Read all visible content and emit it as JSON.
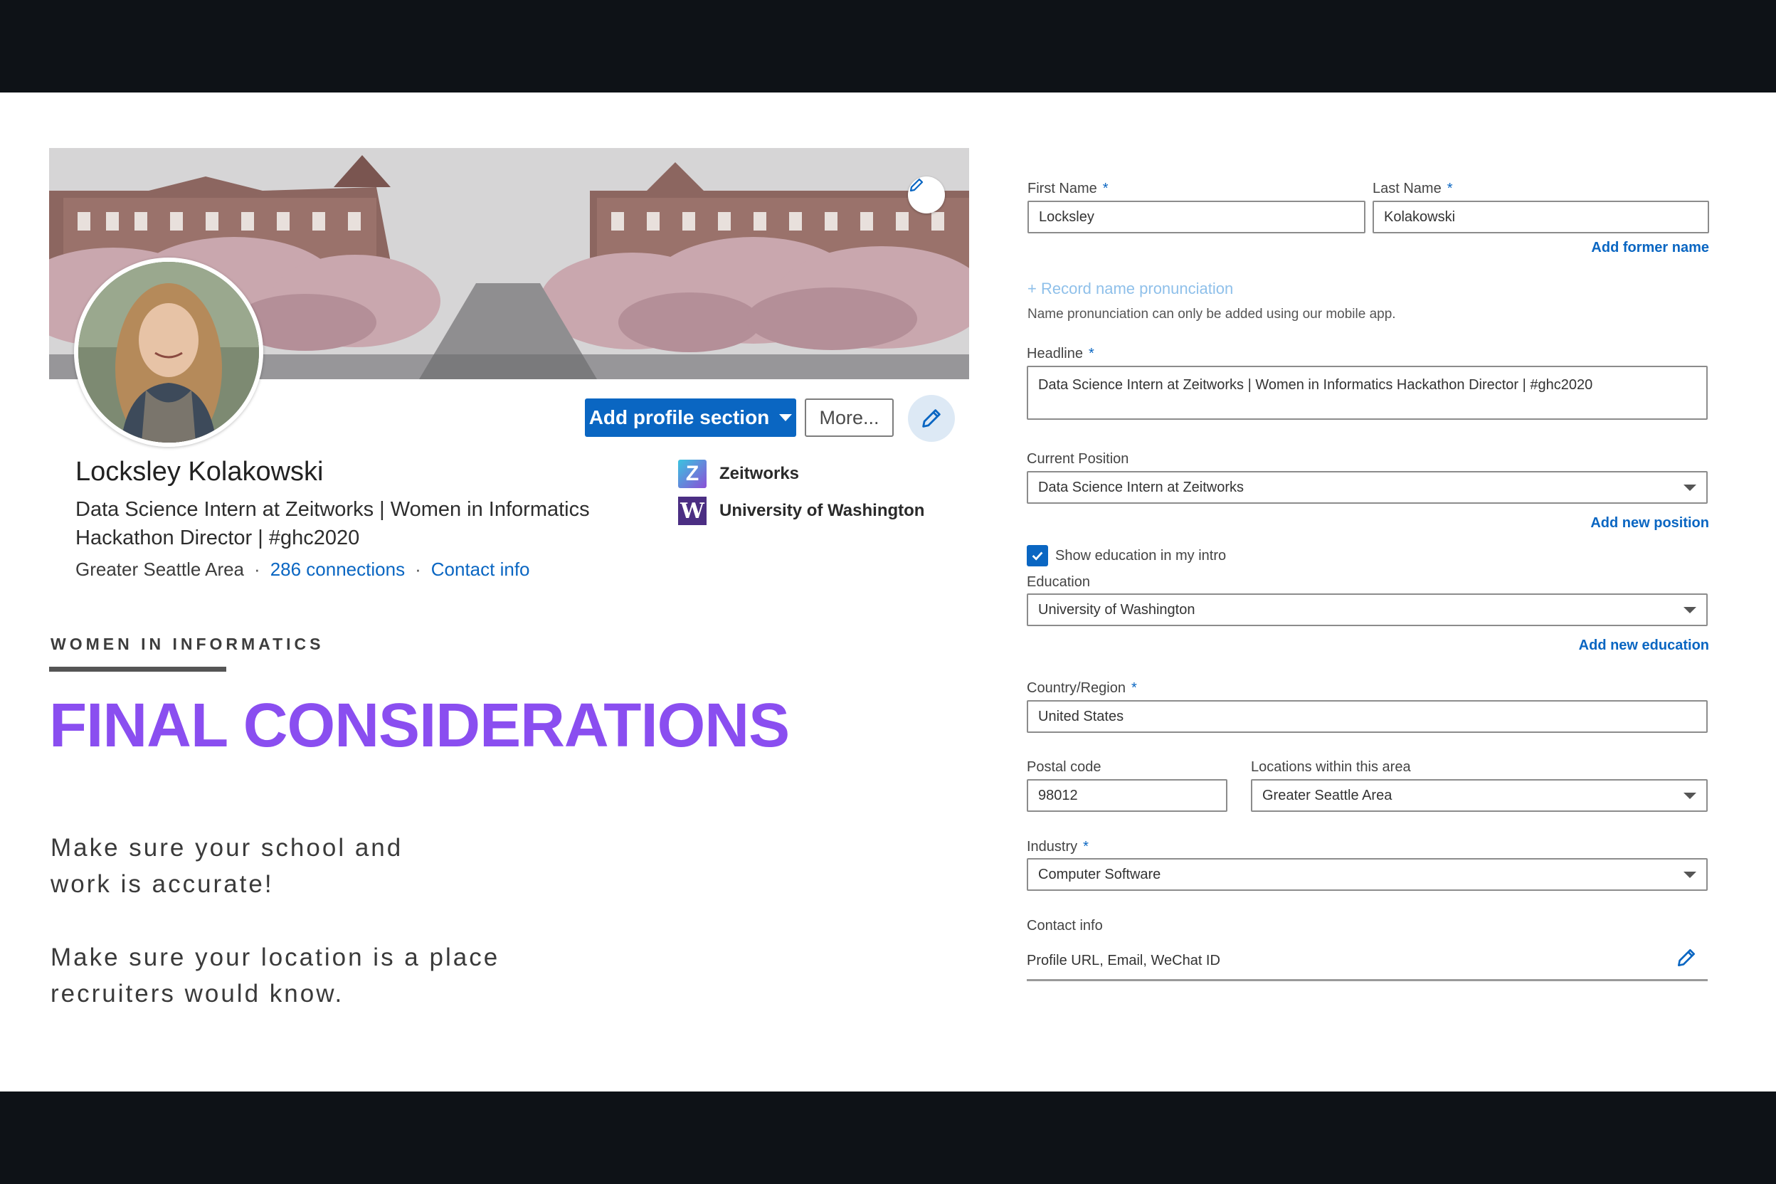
{
  "profile": {
    "name": "Locksley Kolakowski",
    "headline": "Data Science Intern at Zeitworks | Women in Informatics Hackathon Director | #ghc2020",
    "location": "Greater Seattle Area",
    "connections": "286 connections",
    "contact_info": "Contact info",
    "add_profile_section_label": "Add profile section",
    "more_label": "More...",
    "orgs": [
      {
        "name": "Zeitworks",
        "logo_letter": "Z"
      },
      {
        "name": "University of Washington",
        "logo_letter": "W"
      }
    ]
  },
  "slide": {
    "eyebrow": "WOMEN IN INFORMATICS",
    "title": "FINAL CONSIDERATIONS",
    "tips": [
      "Make sure your school and work is accurate!",
      "Make sure your location is a place recruiters would know."
    ]
  },
  "form": {
    "first_name": {
      "label": "First Name",
      "required": "*",
      "value": "Locksley"
    },
    "last_name": {
      "label": "Last Name",
      "required": "*",
      "value": "Kolakowski"
    },
    "add_former_name": "Add former name",
    "record_pronunciation": "+ Record name pronunciation",
    "pronunciation_hint": "Name pronunciation can only be added using our mobile app.",
    "headline": {
      "label": "Headline",
      "required": "*",
      "value": "Data Science Intern at Zeitworks | Women in Informatics Hackathon Director | #ghc2020"
    },
    "current_position": {
      "label": "Current Position",
      "value": "Data Science Intern at Zeitworks"
    },
    "add_new_position": "Add new position",
    "show_education": {
      "label": "Show education in my intro",
      "checked": true
    },
    "education": {
      "label": "Education",
      "value": "University of Washington"
    },
    "add_new_education": "Add new education",
    "country": {
      "label": "Country/Region",
      "required": "*",
      "value": "United States"
    },
    "postal_code": {
      "label": "Postal code",
      "value": "98012"
    },
    "locations": {
      "label": "Locations within this area",
      "value": "Greater Seattle Area"
    },
    "industry": {
      "label": "Industry",
      "required": "*",
      "value": "Computer Software"
    },
    "contact_info": {
      "label": "Contact info",
      "value": "Profile URL, Email, WeChat ID"
    }
  },
  "colors": {
    "linkedin_blue": "#0a66c2",
    "title_purple": "#8a4ef0",
    "background_bars": "#0e1217"
  }
}
